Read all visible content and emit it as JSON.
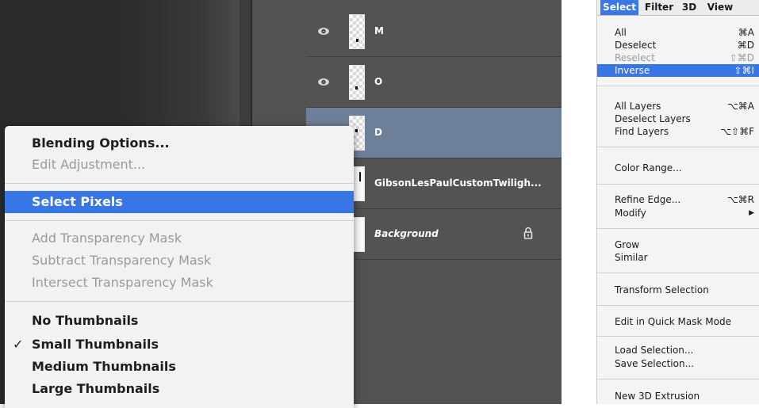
{
  "layers": [
    {
      "name": "M",
      "visible": true,
      "selected": false,
      "italic": false,
      "thumb": "checker"
    },
    {
      "name": "O",
      "visible": true,
      "selected": false,
      "italic": false,
      "thumb": "checker"
    },
    {
      "name": "D",
      "visible": false,
      "selected": true,
      "italic": false,
      "thumb": "checker"
    },
    {
      "name": "GibsonLesPaulCustomTwiligh...",
      "visible": false,
      "selected": false,
      "italic": false,
      "thumb": "white"
    },
    {
      "name": "Background",
      "visible": false,
      "selected": false,
      "italic": true,
      "thumb": "white",
      "locked": true
    }
  ],
  "context_menu": {
    "items": {
      "blending_options": "Blending Options...",
      "edit_adjustment": "Edit Adjustment...",
      "select_pixels": "Select Pixels",
      "add_transparency_mask": "Add Transparency Mask",
      "subtract_transparency_mask": "Subtract Transparency Mask",
      "intersect_transparency_mask": "Intersect Transparency Mask",
      "no_thumbnails": "No Thumbnails",
      "small_thumbnails": "Small Thumbnails",
      "medium_thumbnails": "Medium Thumbnails",
      "large_thumbnails": "Large Thumbnails"
    },
    "check_mark": "✓"
  },
  "menubar": {
    "select": "Select",
    "filter": "Filter",
    "3d": "3D",
    "view": "View"
  },
  "select_menu": {
    "all": {
      "label": "All",
      "shortcut": "⌘A"
    },
    "deselect": {
      "label": "Deselect",
      "shortcut": "⌘D"
    },
    "reselect": {
      "label": "Reselect",
      "shortcut": "⇧⌘D"
    },
    "inverse": {
      "label": "Inverse",
      "shortcut": "⇧⌘I"
    },
    "all_layers": {
      "label": "All Layers",
      "shortcut": "⌥⌘A"
    },
    "deselect_layers": {
      "label": "Deselect Layers",
      "shortcut": ""
    },
    "find_layers": {
      "label": "Find Layers",
      "shortcut": "⌥⇧⌘F"
    },
    "color_range": {
      "label": "Color Range...",
      "shortcut": ""
    },
    "refine_edge": {
      "label": "Refine Edge...",
      "shortcut": "⌥⌘R"
    },
    "modify": {
      "label": "Modify",
      "shortcut": "▶"
    },
    "grow": {
      "label": "Grow",
      "shortcut": ""
    },
    "similar": {
      "label": "Similar",
      "shortcut": ""
    },
    "transform_selection": {
      "label": "Transform Selection",
      "shortcut": ""
    },
    "edit_quick_mask": {
      "label": "Edit in Quick Mask Mode",
      "shortcut": ""
    },
    "load_selection": {
      "label": "Load Selection...",
      "shortcut": ""
    },
    "save_selection": {
      "label": "Save Selection...",
      "shortcut": ""
    },
    "new_3d_extrusion": {
      "label": "New 3D Extrusion",
      "shortcut": ""
    }
  },
  "colors": {
    "highlight": "#3876e6",
    "selected_layer": "#6e7f99",
    "panel": "#535353"
  }
}
